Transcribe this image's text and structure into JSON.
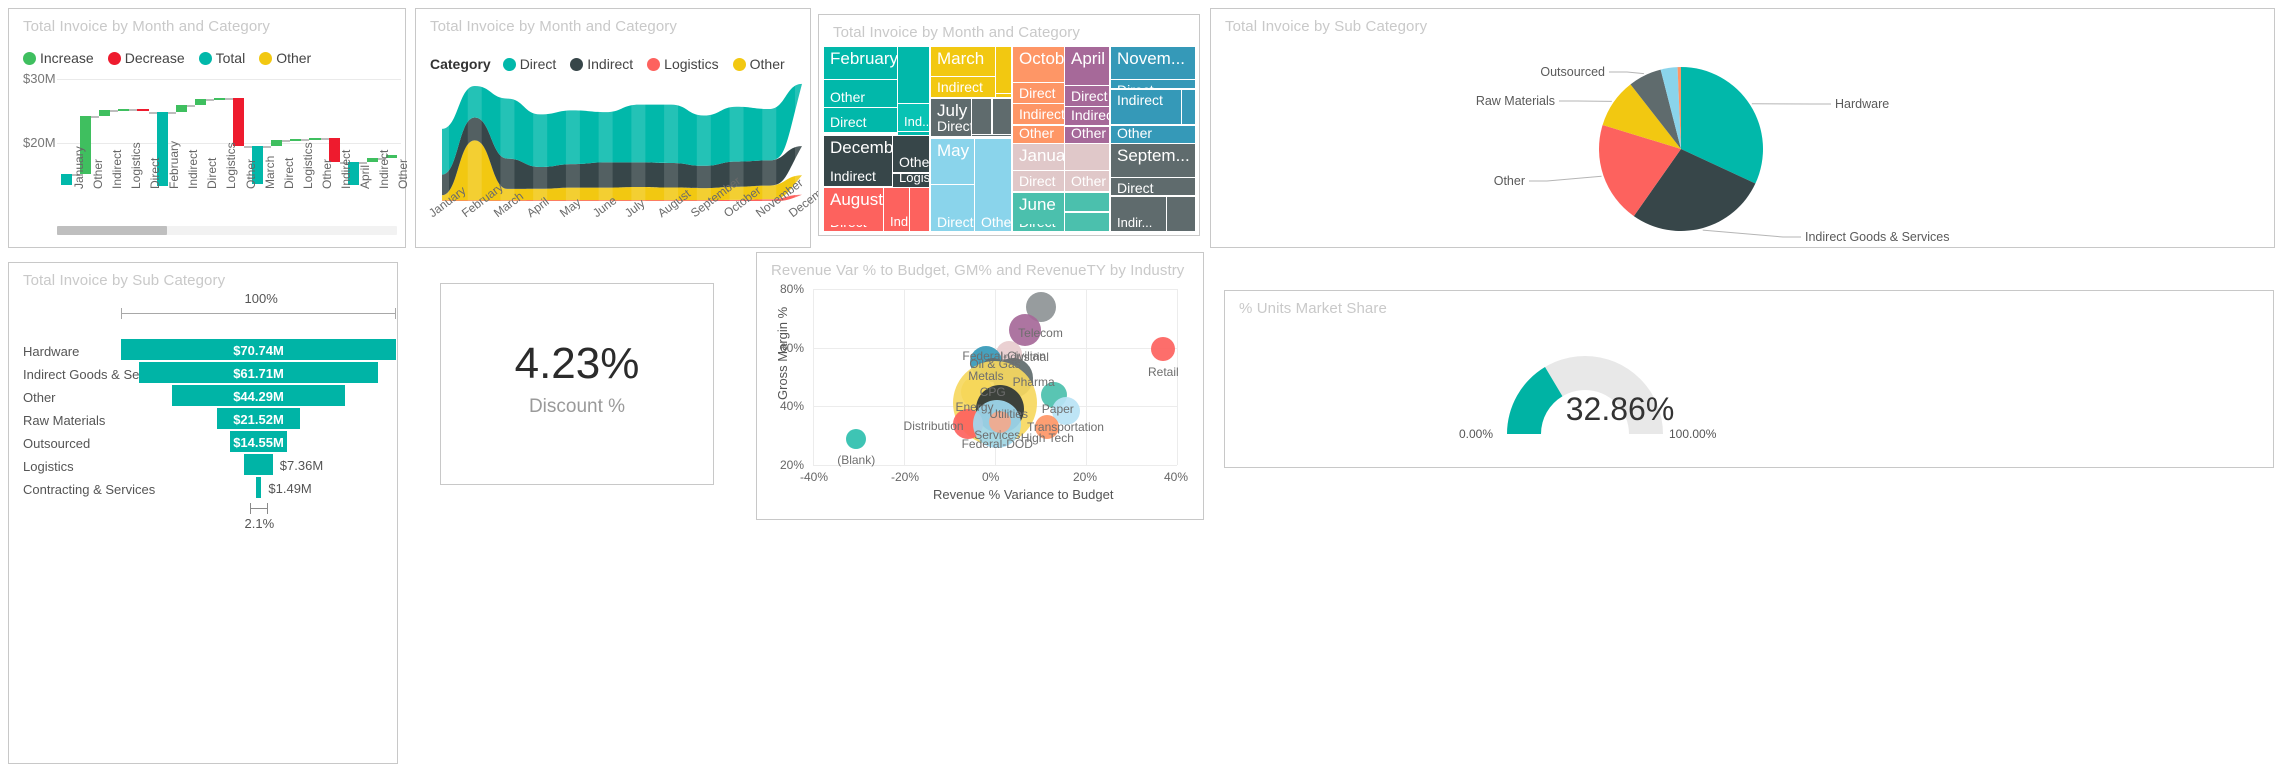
{
  "panels": {
    "waterfall": {
      "title": "Total Invoice by Month and Category"
    },
    "area": {
      "title": "Total Invoice by Month and Category"
    },
    "treemap": {
      "title": "Total Invoice by Month and Category"
    },
    "pie": {
      "title": "Total Invoice by Sub Category"
    },
    "funnel": {
      "title": "Total Invoice by Sub Category"
    },
    "card": {
      "title": ""
    },
    "scatter": {
      "title": "Revenue Var % to Budget, GM% and RevenueTY by Industry"
    },
    "gauge": {
      "title": "% Units Market Share"
    }
  },
  "chart_data": [
    {
      "id": "waterfall",
      "type": "bar",
      "title": "Total Invoice by Month and Category",
      "subtype": "waterfall",
      "xlabel": "",
      "ylabel": "",
      "ylim": [
        13.2,
        31.5
      ],
      "yticks": [
        "$20M",
        "$30M"
      ],
      "grid": true,
      "legend_position": "top",
      "legend": [
        {
          "label": "Increase",
          "color": "#3FBF5F"
        },
        {
          "label": "Decrease",
          "color": "#EE1B2E"
        },
        {
          "label": "Total",
          "color": "#01B8AA"
        },
        {
          "label": "Other",
          "color": "#F2C811"
        }
      ],
      "categories": [
        "January",
        "Other",
        "Indirect",
        "Logistics",
        "Direct",
        "February",
        "Indirect",
        "Direct",
        "Logistics",
        "Other",
        "March",
        "Direct",
        "Logistics",
        "Other",
        "Indirect",
        "April",
        "Indirect",
        "Other"
      ],
      "bars": [
        {
          "label": "January",
          "kind": "Total",
          "start": 13.3,
          "end": 15.1
        },
        {
          "label": "Other",
          "kind": "Increase",
          "start": 15.1,
          "end": 24.2
        },
        {
          "label": "Indirect",
          "kind": "Increase",
          "start": 24.2,
          "end": 25.1
        },
        {
          "label": "Logistics",
          "kind": "Increase",
          "start": 25.1,
          "end": 25.3
        },
        {
          "label": "Direct",
          "kind": "Decrease",
          "start": 25.3,
          "end": 24.9
        },
        {
          "label": "February",
          "kind": "Total",
          "start": 13.1,
          "end": 24.9
        },
        {
          "label": "Indirect",
          "kind": "Increase",
          "start": 24.9,
          "end": 25.9
        },
        {
          "label": "Direct",
          "kind": "Increase",
          "start": 25.9,
          "end": 26.8
        },
        {
          "label": "Logistics",
          "kind": "Increase",
          "start": 26.8,
          "end": 27.0
        },
        {
          "label": "Other",
          "kind": "Decrease",
          "start": 27.0,
          "end": 19.4
        },
        {
          "label": "March",
          "kind": "Total",
          "start": 13.5,
          "end": 19.4
        },
        {
          "label": "Direct",
          "kind": "Increase",
          "start": 19.4,
          "end": 20.4
        },
        {
          "label": "Logistics",
          "kind": "Increase",
          "start": 20.4,
          "end": 20.6
        },
        {
          "label": "Other",
          "kind": "Increase",
          "start": 20.6,
          "end": 20.7
        },
        {
          "label": "Indirect",
          "kind": "Decrease",
          "start": 20.7,
          "end": 16.9
        },
        {
          "label": "April",
          "kind": "Total",
          "start": 13.3,
          "end": 16.9
        },
        {
          "label": "Indirect",
          "kind": "Increase",
          "start": 16.9,
          "end": 17.6
        },
        {
          "label": "Other",
          "kind": "Increase",
          "start": 17.6,
          "end": 18.1
        }
      ],
      "scrollbar": {
        "thumb_start_pct": 0,
        "thumb_width_pct": 32
      }
    },
    {
      "id": "area",
      "type": "area",
      "subtype": "stacked-area",
      "title": "Total Invoice by Month and Category",
      "legend_title": "Category",
      "legend_position": "top",
      "legend": [
        {
          "label": "Direct",
          "color": "#01B8AA"
        },
        {
          "label": "Indirect",
          "color": "#374649"
        },
        {
          "label": "Logistics",
          "color": "#FD625E"
        },
        {
          "label": "Other",
          "color": "#F2C811"
        }
      ],
      "categories": [
        "January",
        "February",
        "March",
        "April",
        "May",
        "June",
        "July",
        "August",
        "September",
        "October",
        "November",
        "December"
      ],
      "series": [
        {
          "name": "Other",
          "color": "#F2C811",
          "values": [
            0.9,
            10.5,
            2.0,
            2.0,
            2.2,
            2.2,
            2.3,
            2.2,
            2.1,
            2.3,
            2.4,
            3.4
          ]
        },
        {
          "name": "Logistics",
          "color": "#FD625E",
          "values": [
            0.12,
            0.12,
            0.12,
            0.15,
            0.15,
            0.15,
            0.16,
            0.16,
            0.16,
            0.2,
            0.3,
            1.1
          ]
        },
        {
          "name": "Indirect",
          "color": "#374649",
          "values": [
            3.6,
            4.0,
            5.3,
            3.8,
            4.1,
            4.4,
            4.3,
            4.3,
            3.9,
            4.4,
            4.4,
            5.1
          ]
        },
        {
          "name": "Direct",
          "color": "#01B8AA",
          "values": [
            8.0,
            5.5,
            10.5,
            9.2,
            9.4,
            8.8,
            10.1,
            10.2,
            8.8,
            9.6,
            9.0,
            10.9
          ]
        }
      ],
      "ylim": [
        0,
        21
      ]
    },
    {
      "id": "treemap",
      "type": "heatmap",
      "subtype": "treemap",
      "title": "Total Invoice by Month and Category",
      "groups": [
        {
          "name": "February",
          "color": "#01B8AA",
          "children": [
            "Other",
            "Direct",
            "Ind..."
          ]
        },
        {
          "name": "December",
          "color": "#374649",
          "children": [
            "Other",
            "Indirect",
            "Logis..."
          ]
        },
        {
          "name": "August",
          "color": "#FD625E",
          "children": [
            "Direct",
            "Ind..."
          ]
        },
        {
          "name": "March",
          "color": "#F2C811",
          "children": [
            "Indirect"
          ]
        },
        {
          "name": "July",
          "color": "#5F6B6D",
          "children": [
            "Direct"
          ]
        },
        {
          "name": "May",
          "color": "#8AD4EB",
          "children": [
            "Direct",
            "Other"
          ]
        },
        {
          "name": "October",
          "color": "#FE9666",
          "children": [
            "Direct",
            "Indirect",
            "Other"
          ]
        },
        {
          "name": "January",
          "color": "#E0C8C9",
          "children": [
            "Direct",
            "Other"
          ]
        },
        {
          "name": "June",
          "color": "#4BC0AD",
          "children": [
            "Direct"
          ]
        },
        {
          "name": "April",
          "color": "#A66999",
          "children": [
            "Direct",
            "Indirect",
            "Other"
          ]
        },
        {
          "name": "Novem...",
          "color": "#3599B8",
          "children": [
            "Direct",
            "Indirect",
            "Other"
          ]
        },
        {
          "name": "Septem...",
          "color": "#5F6B6D",
          "children": [
            "Direct",
            "Indir..."
          ]
        }
      ]
    },
    {
      "id": "pie",
      "type": "pie",
      "title": "Total Invoice by Sub Category",
      "labels": [
        "Hardware",
        "Indirect Goods & Services",
        "Other",
        "Raw Materials",
        "Outsourced",
        "Logistics",
        "Contracting & Services"
      ],
      "values": [
        70.74,
        61.71,
        44.29,
        21.52,
        14.55,
        7.36,
        1.49
      ],
      "colors": [
        "#01B8AA",
        "#374649",
        "#FD625E",
        "#F2C811",
        "#5F6B6D",
        "#8AD4EB",
        "#FE9666"
      ],
      "shown_labels": [
        "Hardware",
        "Indirect Goods & Services",
        "Other",
        "Raw Materials",
        "Outsourced"
      ]
    },
    {
      "id": "funnel",
      "type": "bar",
      "subtype": "funnel",
      "title": "Total Invoice by Sub Category",
      "top_pct": "100%",
      "bottom_pct": "2.1%",
      "bar_color": "#00B3A4",
      "categories": [
        "Hardware",
        "Indirect Goods & Ser...",
        "Other",
        "Raw Materials",
        "Outsourced",
        "Logistics",
        "Contracting & Services"
      ],
      "values": [
        70.74,
        61.71,
        44.29,
        21.52,
        14.55,
        7.36,
        1.49
      ],
      "value_labels": [
        "$70.74M",
        "$61.71M",
        "$44.29M",
        "$21.52M",
        "$14.55M",
        "$7.36M",
        "$1.49M"
      ],
      "labels_inside": [
        true,
        true,
        true,
        true,
        true,
        false,
        false
      ]
    },
    {
      "id": "card",
      "type": "table",
      "subtype": "kpi-card",
      "value": "4.23%",
      "caption": "Discount %"
    },
    {
      "id": "scatter",
      "type": "scatter",
      "subtype": "bubble",
      "title": "Revenue Var % to Budget, GM% and RevenueTY by Industry",
      "xlabel": "Revenue % Variance to Budget",
      "ylabel": "Gross Margin %",
      "xticks": [
        "-40%",
        "-20%",
        "0%",
        "20%",
        "40%"
      ],
      "yticks": [
        "20%",
        "40%",
        "60%",
        "80%"
      ],
      "xlim": [
        -40,
        40
      ],
      "ylim": [
        20,
        80
      ],
      "grid": true,
      "points": [
        {
          "label": "Telecom",
          "x": 10.0,
          "y": 74.0,
          "r": 15,
          "color": "#8E9496"
        },
        {
          "label": "Industrial",
          "x": 6.5,
          "y": 66.0,
          "r": 16,
          "color": "#A66999"
        },
        {
          "label": "Retail",
          "x": 37.0,
          "y": 59.5,
          "r": 12,
          "color": "#FD625E"
        },
        {
          "label": "Federal-Civilian",
          "x": 3.0,
          "y": 58.0,
          "r": 13,
          "color": "#E8CCCE"
        },
        {
          "label": "Oil & Gas",
          "x": -2.0,
          "y": 55.0,
          "r": 16,
          "color": "#3599B8"
        },
        {
          "label": "Metals",
          "x": -0.5,
          "y": 52.5,
          "r": 12,
          "color": "#5F6B6D"
        },
        {
          "label": "Pharma",
          "x": 4.0,
          "y": 49.5,
          "r": 20,
          "color": "#5F6B6D"
        },
        {
          "label": "CPG",
          "x": -4.0,
          "y": 45.0,
          "r": 16,
          "color": "#F2C811"
        },
        {
          "label": "Paper",
          "x": 13.0,
          "y": 44.0,
          "r": 13,
          "color": "#4BC0AD"
        },
        {
          "label": "Energy",
          "x": 0.0,
          "y": 41.0,
          "r": 42,
          "color": "#F6D860"
        },
        {
          "label": "Utilities",
          "x": 1.0,
          "y": 39.0,
          "r": 24,
          "color": "#2B3437"
        },
        {
          "label": "Transportation",
          "x": 15.5,
          "y": 38.5,
          "r": 14,
          "color": "#B9E3F5"
        },
        {
          "label": "Distribution",
          "x": -6.0,
          "y": 34.0,
          "r": 15,
          "color": "#FD625E"
        },
        {
          "label": "High Tech",
          "x": 11.5,
          "y": 33.0,
          "r": 12,
          "color": "#FE9666"
        },
        {
          "label": "Federal-DOD",
          "x": 0.5,
          "y": 34.0,
          "r": 24,
          "color": "#9FD9F0"
        },
        {
          "label": "Services",
          "x": 1.0,
          "y": 34.5,
          "r": 11,
          "color": "#F3A98C"
        },
        {
          "label": "(Blank)",
          "x": -30.5,
          "y": 29.0,
          "r": 10,
          "color": "#2EBFAE"
        }
      ]
    },
    {
      "id": "gauge",
      "type": "pie",
      "subtype": "gauge",
      "title": "% Units Market Share",
      "value": 32.86,
      "value_label": "32.86%",
      "min_label": "0.00%",
      "max_label": "100.00%",
      "fill_color": "#00B3A4",
      "track_color": "#E8E8E8"
    }
  ]
}
